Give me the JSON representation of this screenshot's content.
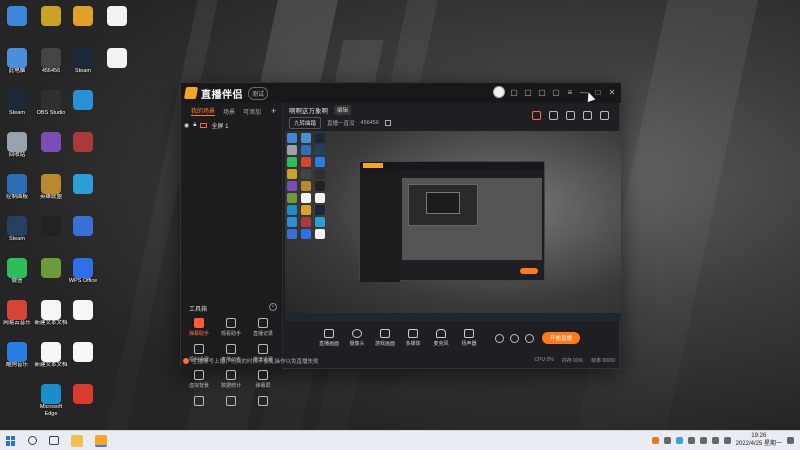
{
  "desktop": {
    "col1": [
      {
        "label": "",
        "color": "#3d87d9"
      },
      {
        "label": "此电脑",
        "color": "#4a90d9"
      },
      {
        "label": "Steam",
        "color": "#1b2838"
      },
      {
        "label": "回收站",
        "color": "#9aa3ad"
      },
      {
        "label": "控制面板",
        "color": "#2d6fb5"
      },
      {
        "label": "Steam",
        "color": "#23415e"
      },
      {
        "label": "微信",
        "color": "#2ebd5a"
      },
      {
        "label": "网易云音乐",
        "color": "#d64534"
      },
      {
        "label": "酷狗音乐",
        "color": "#2a7de1"
      }
    ],
    "col2": [
      {
        "label": "",
        "color": "#c9a227"
      },
      {
        "label": "456456",
        "color": "#444"
      },
      {
        "label": "OBS Studio",
        "color": "#302e31"
      },
      {
        "label": "",
        "color": "#7a4fb5"
      },
      {
        "label": "英雄联盟",
        "color": "#b9892f"
      },
      {
        "label": "",
        "color": "#222"
      },
      {
        "label": "",
        "color": "#6d9b3c"
      },
      {
        "label": "新建文本文档",
        "color": "#f6f6f6"
      },
      {
        "label": "新建文本文档",
        "color": "#f6f6f6"
      },
      {
        "label": "Microsoft Edge",
        "color": "#1b8ec9"
      }
    ],
    "col3": [
      {
        "label": "",
        "color": "#e0a12a"
      },
      {
        "label": "Steam",
        "color": "#1b2838"
      },
      {
        "label": "",
        "color": "#2b8fd6"
      },
      {
        "label": "",
        "color": "#a83a3a"
      },
      {
        "label": "",
        "color": "#2a9fd6"
      },
      {
        "label": "",
        "color": "#3b6fd8"
      },
      {
        "label": "WPS Office",
        "color": "#2f6fe8"
      },
      {
        "label": "",
        "color": "#f6f6f6"
      },
      {
        "label": "",
        "color": "#f6f6f6"
      },
      {
        "label": "",
        "color": "#d93b2f"
      }
    ],
    "col4": [
      {
        "label": "",
        "color": "#f2f2f2"
      },
      {
        "label": "",
        "color": "#f2f2f2"
      }
    ]
  },
  "app": {
    "name": "直播伴侣",
    "version": "测试",
    "tabs": [
      "我的场景",
      "场景",
      "可添加"
    ],
    "scene": "全屏 1",
    "title": "啊啊这万象啊",
    "title_badge": "编辑",
    "sub_tag": "九转曲踏",
    "sub_info": "直播一直没",
    "sub_id": "456456",
    "toolbox_title": "工具箱",
    "collapse_glyph": "‹",
    "tools": [
      {
        "label": "弹幕助手",
        "hot": true
      },
      {
        "label": "观看助手",
        "hot": false
      },
      {
        "label": "直播记录",
        "hot": false
      },
      {
        "label": "福利设置",
        "hot": false
      },
      {
        "label": "直播公告",
        "hot": false
      },
      {
        "label": "推流设置",
        "hot": false
      },
      {
        "label": "虚拟背景",
        "hot": false
      },
      {
        "label": "数据统计",
        "hot": false
      },
      {
        "label": "弹幕屏",
        "hot": false
      },
      {
        "label": "",
        "hot": false
      },
      {
        "label": "",
        "hot": false
      },
      {
        "label": "",
        "hot": false
      }
    ],
    "bottom_tools": [
      "直播画面",
      "摄像头",
      "游戏画面",
      "多媒体",
      "麦克风",
      "扬声器"
    ],
    "live_button": "开始直播",
    "notice": "主播账号上播，切换的时候不要乱操作以免直播失败",
    "status": [
      "CPU 0%",
      "内存 00%",
      "帧率 00/00"
    ]
  },
  "taskbar": {
    "time": "19:26",
    "date": "2022/4/25 星期一"
  }
}
